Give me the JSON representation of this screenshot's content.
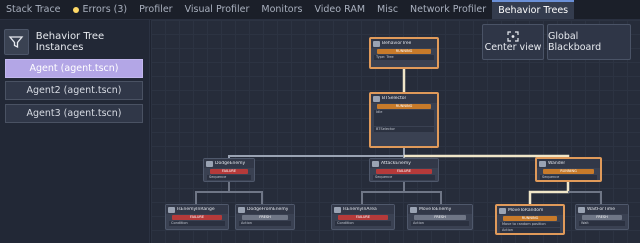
{
  "tabs": [
    {
      "label": "Stack Trace",
      "active": false
    },
    {
      "label": "Errors (3)",
      "active": false,
      "dot": true
    },
    {
      "label": "Profiler",
      "active": false
    },
    {
      "label": "Visual Profiler",
      "active": false
    },
    {
      "label": "Monitors",
      "active": false
    },
    {
      "label": "Video RAM",
      "active": false
    },
    {
      "label": "Misc",
      "active": false
    },
    {
      "label": "Network Profiler",
      "active": false
    },
    {
      "label": "Behavior Trees",
      "active": true
    }
  ],
  "left_panel": {
    "title": "Behavior Tree Instances",
    "instances": [
      {
        "label": "Agent (agent.tscn)",
        "selected": true
      },
      {
        "label": "Agent2 (agent.tscn)",
        "selected": false
      },
      {
        "label": "Agent3 (agent.tscn)",
        "selected": false
      }
    ]
  },
  "graph": {
    "center_view": "Center view",
    "global_blackboard": "Global Blackboard",
    "nodes": [
      {
        "title": "BehaviorTree",
        "bar": "RUNNING",
        "rows": [
          "Type: Tree"
        ]
      },
      {
        "title": "BTSelector",
        "bar": "RUNNING",
        "rows": [
          "Idle",
          "BTSelector"
        ]
      },
      {
        "title": "DodgeEnemy",
        "bar": "FAILURE",
        "rows": [
          "Sequence"
        ]
      },
      {
        "title": "AttackEnemy",
        "bar": "FAILURE",
        "rows": [
          "Sequence"
        ]
      },
      {
        "title": "Wander",
        "bar": "RUNNING",
        "rows": [
          "Sequence"
        ]
      },
      {
        "title": "IsEnemyInRange",
        "bar": "FAILURE",
        "rows": [
          "Condition"
        ]
      },
      {
        "title": "DodgeFromEnemy",
        "bar": "FRESH",
        "rows": [
          "Action"
        ]
      },
      {
        "title": "IsEnemyInArea",
        "bar": "FAILURE",
        "rows": [
          "Condition"
        ]
      },
      {
        "title": "MoveToEnemy",
        "bar": "FRESH",
        "rows": [
          "Action"
        ]
      },
      {
        "title": "MoveToRandom",
        "bar": "RUNNING",
        "rows": [
          "Move to random position",
          "Action"
        ]
      },
      {
        "title": "WaitForTime",
        "bar": "FRESH",
        "rows": [
          "Wait"
        ]
      }
    ]
  },
  "colors": {
    "running": "#c77a2a",
    "failure": "#b53a3a",
    "fresh": "#6f7686",
    "highlight": "#e09a5a",
    "selected": "#b3a6e6"
  }
}
